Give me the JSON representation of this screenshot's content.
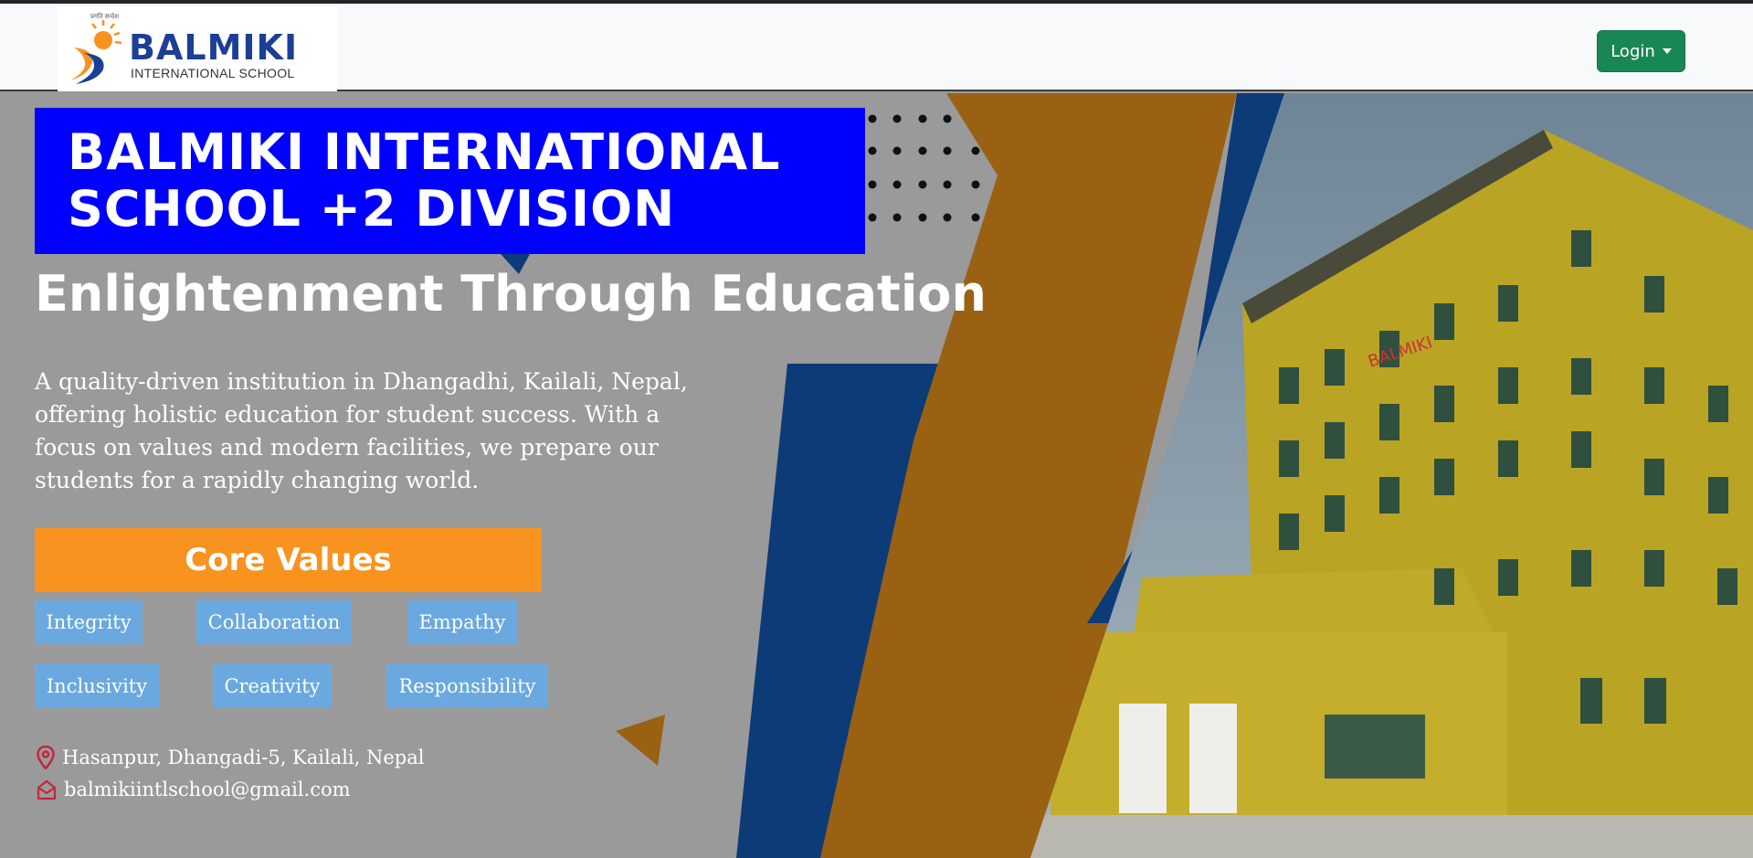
{
  "header": {
    "logo": {
      "tagline": "प्रगति सन्देश",
      "name": "BALMIKI",
      "subtitle": "INTERNATIONAL SCHOOL"
    },
    "login_label": "Login"
  },
  "hero": {
    "title": "BALMIKI INTERNATIONAL SCHOOL +2 DIVISION",
    "tagline": "Enlightenment Through Education",
    "description": "A quality-driven institution in Dhangadhi, Kailali, Nepal, offering holistic education for student success. With a focus on values and modern facilities, we prepare our students for a rapidly changing world.",
    "core_values_heading": "Core Values",
    "core_values": [
      "Integrity",
      "Collaboration",
      "Empathy",
      "Inclusivity",
      "Creativity",
      "Responsibility"
    ],
    "address": "Hasanpur, Dhangadi-5, Kailali, Nepal",
    "email": "balmikiintlschool@gmail.com"
  },
  "colors": {
    "title_bg": "#0000ff",
    "core_values_bg": "#f7931e",
    "chip_bg": "#6aa8e0",
    "login_bg": "#198754",
    "stripe_orange": "#9a6113",
    "stripe_blue": "#0c3b78",
    "building_yellow": "#c8b02a"
  },
  "icons": {
    "location": "map-pin-icon",
    "email": "envelope-open-icon",
    "dropdown": "caret-down-icon"
  }
}
